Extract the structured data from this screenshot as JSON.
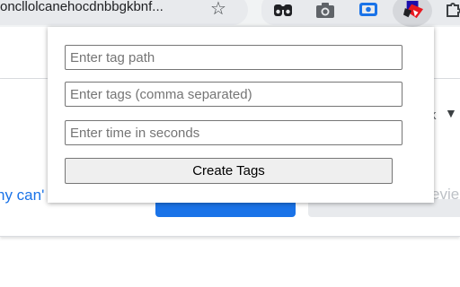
{
  "browser": {
    "url_fragment": "oncllolcanehocdnbbgkbnf...",
    "bookmark_icon": "star-outline-icon",
    "extensions": [
      "binoculars-icon",
      "camera-icon",
      "screen-record-icon",
      "tag-extension-icon",
      "puzzle-icon"
    ]
  },
  "popup": {
    "tag_path_placeholder": "Enter tag path",
    "tag_path_value": "",
    "tags_placeholder": "Enter tags (comma separated)",
    "tags_value": "",
    "time_placeholder": "Enter time in seconds",
    "time_value": "",
    "create_button_label": "Create Tags"
  },
  "background": {
    "left_link_fragment": "ny can'",
    "right_button_fragment": "evie",
    "caret_fragment": "k"
  }
}
